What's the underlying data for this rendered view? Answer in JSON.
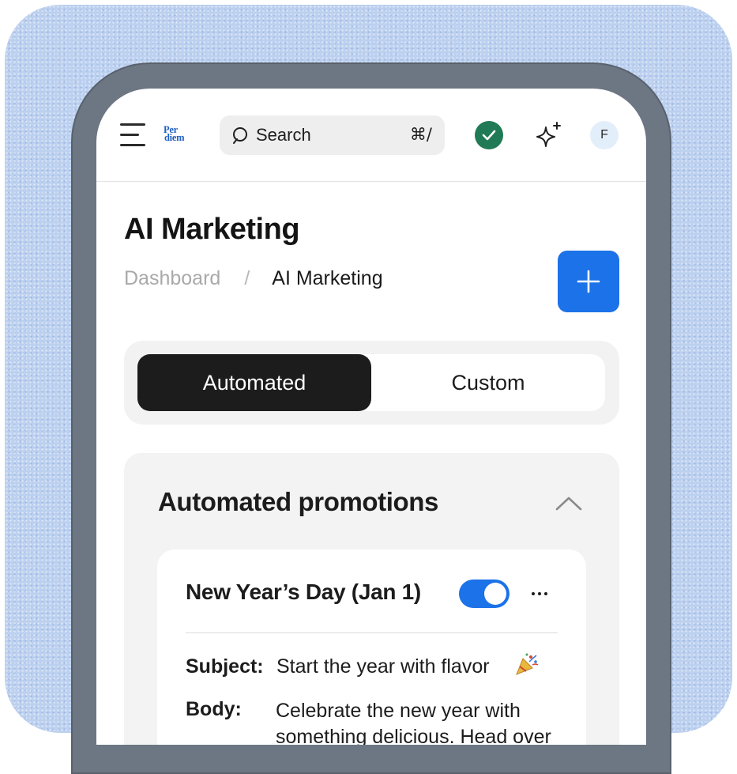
{
  "header": {
    "logo_line1": "Per",
    "logo_line2": "diem",
    "search_label": "Search",
    "search_shortcut": "⌘/",
    "avatar_initial": "F"
  },
  "page": {
    "title": "AI Marketing",
    "breadcrumb": [
      "Dashboard",
      "/",
      "AI Marketing"
    ]
  },
  "tabs": [
    {
      "label": "Automated",
      "active": true
    },
    {
      "label": "Custom",
      "active": false
    }
  ],
  "promotions": {
    "title": "Automated promotions",
    "card": {
      "title": "New Year’s Day (Jan 1)",
      "enabled": true,
      "subject_label": "Subject:",
      "subject": "Start the year with flavor",
      "body_label": "Body:",
      "body": "Celebrate the new year with something delicious. Head over"
    }
  },
  "colors": {
    "accent": "#1c72e8",
    "status_green": "#1f7a55",
    "active_tab": "#1c1c1c",
    "frame": "#bcd0ef"
  },
  "icons": [
    "menu-icon",
    "search-icon",
    "check-icon",
    "sparkle-icon",
    "plus-icon",
    "chevron-up-icon",
    "more-icon",
    "party-popper-icon"
  ]
}
